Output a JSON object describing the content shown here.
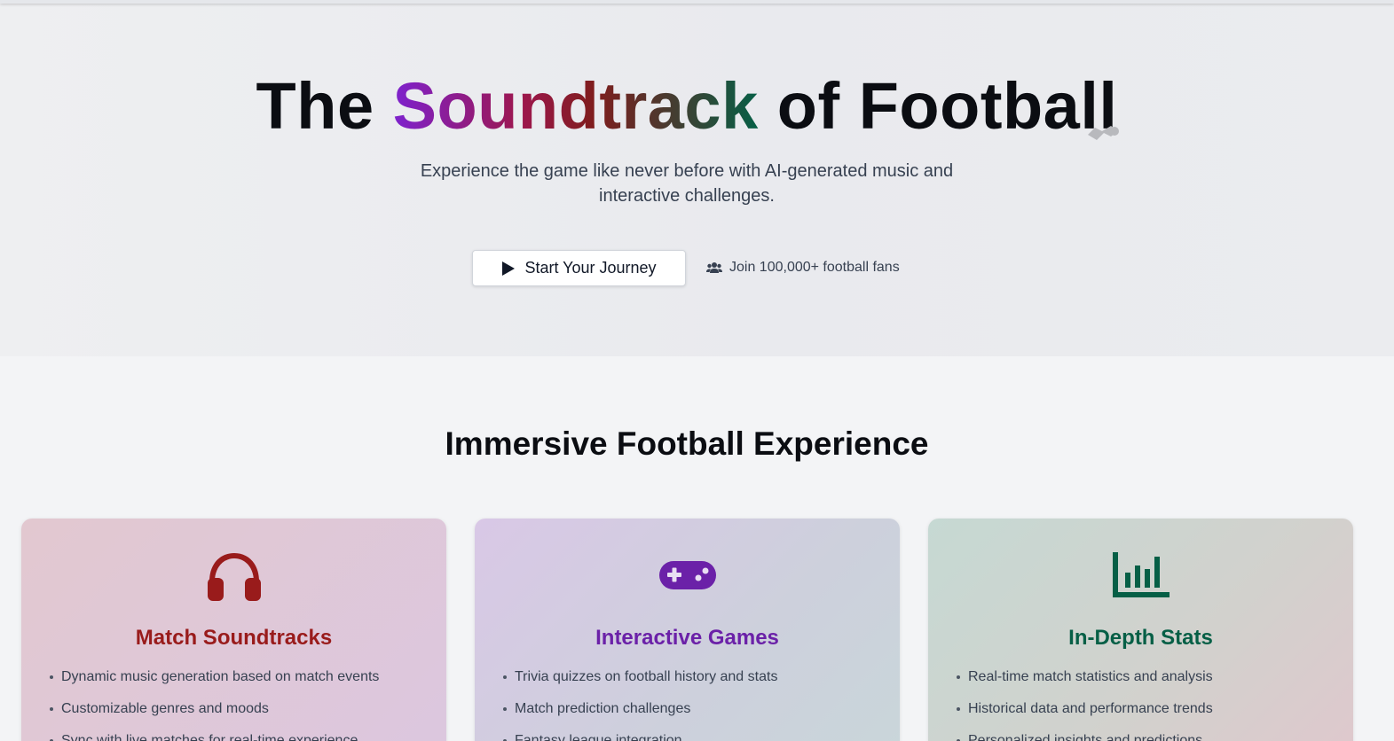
{
  "hero": {
    "title_before": "The ",
    "title_highlight": "Soundtrack",
    "title_after": " of Football",
    "subtitle": "Experience the game like never before with AI-generated music and interactive challenges.",
    "start_button": "Start Your Journey",
    "join_text": "Join 100,000+ football fans"
  },
  "features": {
    "title": "Immersive Football Experience",
    "cards": [
      {
        "title": "Match Soundtracks",
        "icon": "headphones-icon",
        "color": "#991b1b",
        "items": [
          "Dynamic music generation based on match events",
          "Customizable genres and moods",
          "Sync with live matches for real-time experience"
        ]
      },
      {
        "title": "Interactive Games",
        "icon": "gamepad-icon",
        "color": "#6b21a8",
        "items": [
          "Trivia quizzes on football history and stats",
          "Match prediction challenges",
          "Fantasy league integration"
        ]
      },
      {
        "title": "In-Depth Stats",
        "icon": "bar-chart-icon",
        "color": "#065f46",
        "items": [
          "Real-time match statistics and analysis",
          "Historical data and performance trends",
          "Personalized insights and predictions"
        ]
      }
    ]
  }
}
